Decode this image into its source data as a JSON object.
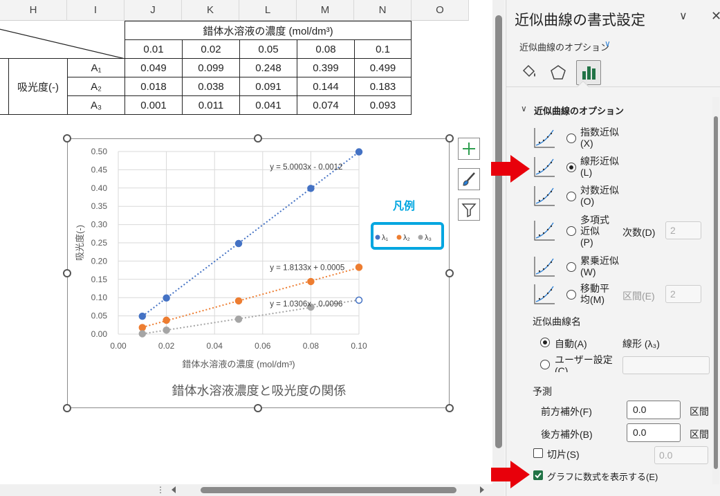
{
  "columns": [
    "H",
    "I",
    "J",
    "K",
    "L",
    "M",
    "N",
    "O"
  ],
  "table": {
    "header": "錯体水溶液の濃度 (mol/dm³)",
    "concentrations": [
      "0.01",
      "0.02",
      "0.05",
      "0.08",
      "0.1"
    ],
    "group_label": "吸光度(-)",
    "rows": [
      {
        "label": "A₁",
        "values": [
          "0.049",
          "0.099",
          "0.248",
          "0.399",
          "0.499"
        ]
      },
      {
        "label": "A₂",
        "values": [
          "0.018",
          "0.038",
          "0.091",
          "0.144",
          "0.183"
        ]
      },
      {
        "label": "A₃",
        "values": [
          "0.001",
          "0.011",
          "0.041",
          "0.074",
          "0.093"
        ]
      }
    ]
  },
  "chart_data": {
    "type": "scatter",
    "title": "錯体水溶液濃度と吸光度の関係",
    "xlabel": "錯体水溶液の濃度 (mol/dm³)",
    "ylabel": "吸光度(-)",
    "xlim": [
      0,
      0.1
    ],
    "ylim": [
      0,
      0.5
    ],
    "x_ticks": [
      "0.00",
      "0.02",
      "0.04",
      "0.06",
      "0.08",
      "0.10"
    ],
    "y_ticks": [
      "0.00",
      "0.05",
      "0.10",
      "0.15",
      "0.20",
      "0.25",
      "0.30",
      "0.35",
      "0.40",
      "0.45",
      "0.50"
    ],
    "grid": true,
    "legend_heading": "凡例",
    "legend_position": "right",
    "series": [
      {
        "name": "λ₁",
        "color": "#4472c4",
        "x": [
          0.01,
          0.02,
          0.05,
          0.08,
          0.1
        ],
        "y": [
          0.049,
          0.099,
          0.248,
          0.399,
          0.499
        ],
        "trendline": "y = 5.0003x - 0.0012"
      },
      {
        "name": "λ₂",
        "color": "#ed7d31",
        "x": [
          0.01,
          0.02,
          0.05,
          0.08,
          0.1
        ],
        "y": [
          0.018,
          0.038,
          0.091,
          0.144,
          0.183
        ],
        "trendline": "y = 1.8133x + 0.0005"
      },
      {
        "name": "λ₃",
        "color": "#a5a5a5",
        "x": [
          0.01,
          0.02,
          0.05,
          0.08,
          0.1
        ],
        "y": [
          0.001,
          0.011,
          0.041,
          0.074,
          0.093
        ],
        "trendline": "y = 1.0306x - 0.0096"
      }
    ]
  },
  "pane": {
    "title": "近似曲線の書式設定",
    "subtitle": "近似曲線のオプション",
    "section": "近似曲線のオプション",
    "options": [
      {
        "label1": "指数近似",
        "label2": "(X)",
        "selected": false
      },
      {
        "label1": "線形近似",
        "label2": "(L)",
        "selected": true
      },
      {
        "label1": "対数近似",
        "label2": "(O)",
        "selected": false
      },
      {
        "label1": "多項式",
        "label2": "近似",
        "label3": "(P)",
        "selected": false
      },
      {
        "label1": "累乗近似",
        "label2": "(W)",
        "selected": false
      },
      {
        "label1": "移動平",
        "label2": "均(M)",
        "selected": false
      }
    ],
    "order_label": "次数(D)",
    "order_value": "2",
    "period_label": "区間(E)",
    "period_value": "2",
    "name_section": "近似曲線名",
    "auto_label": "自動(A)",
    "auto_value": "線形 (λ₃)",
    "custom_label": "ユーザー設定",
    "custom_label2": "(C)",
    "forecast": "予測",
    "forward_label": "前方補外(F)",
    "forward_value": "0.0",
    "backward_label": "後方補外(B)",
    "backward_value": "0.0",
    "interval_unit": "区間",
    "intercept_label": "切片(S)",
    "intercept_value": "0.0",
    "show_equation_label": "グラフに数式を表示する(E)"
  }
}
